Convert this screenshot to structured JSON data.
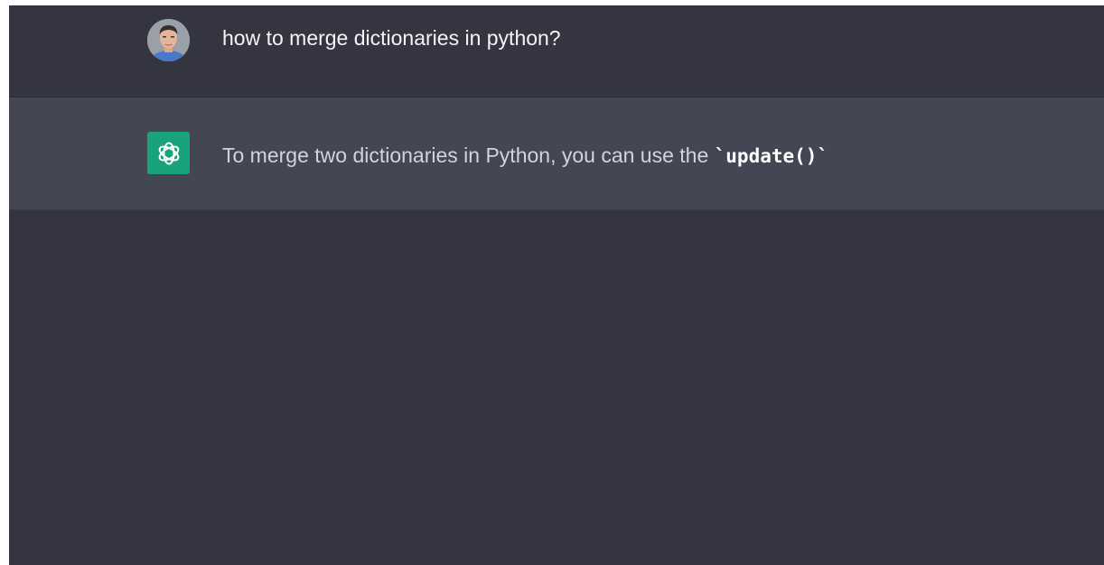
{
  "conversation": {
    "user_message": {
      "text": "how to merge dictionaries in python?"
    },
    "assistant_message": {
      "text_prefix": "To merge two dictionaries in Python, you can use the ",
      "code": "`update()`"
    }
  },
  "colors": {
    "background": "#343541",
    "assistant_row": "#444654",
    "bot_avatar": "#19a37d"
  },
  "icons": {
    "user_avatar": "user-avatar-photo",
    "bot_avatar": "openai-logo-icon"
  }
}
